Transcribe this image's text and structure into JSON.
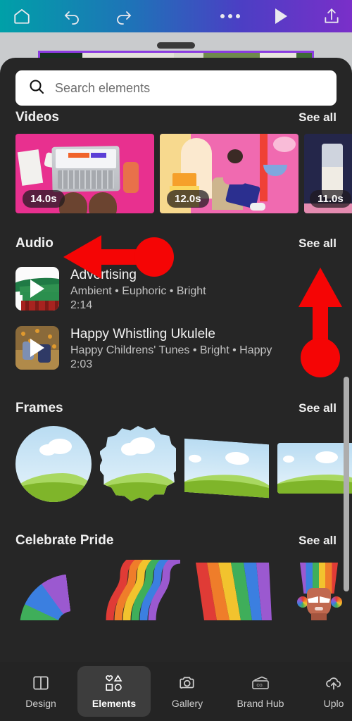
{
  "topbar": {
    "icons": [
      "home-icon",
      "undo-icon",
      "redo-icon",
      "more-options-icon",
      "play-icon",
      "share-icon"
    ],
    "gradient_from": "#00a0a8",
    "gradient_to": "#7a2fc9"
  },
  "search": {
    "placeholder": "Search elements",
    "value": "",
    "icon": "search-icon"
  },
  "sections": {
    "videos": {
      "title": "Videos",
      "see_all": "See all",
      "items": [
        {
          "duration": "14.0s",
          "art": "laptop-desk-flatlay"
        },
        {
          "duration": "12.0s",
          "art": "woman-headphones-pink-room"
        },
        {
          "duration": "11.0s",
          "art": "wine-glass-dark"
        }
      ]
    },
    "audio": {
      "title": "Audio",
      "see_all": "See all",
      "tracks": [
        {
          "title": "Advertising",
          "tags": "Ambient • Euphoric • Bright",
          "duration": "2:14",
          "art": "korean-temple"
        },
        {
          "title": "Happy Whistling Ukulele",
          "tags": "Happy Childrens' Tunes • Bright • Happy",
          "duration": "2:03",
          "art": "children-autumn-leaves"
        }
      ]
    },
    "frames": {
      "title": "Frames",
      "see_all": "See all",
      "items": [
        "circle-frame",
        "scalloped-frame",
        "skewed-rectangle-frame",
        "rectangle-frame"
      ]
    },
    "pride": {
      "title": "Celebrate Pride",
      "see_all": "See all",
      "items": [
        "rainbow-curve",
        "rainbow-wave",
        "rainbow-fan",
        "drag-queen-rainbow-hair"
      ]
    }
  },
  "bottom_nav": {
    "items": [
      {
        "label": "Design",
        "icon": "layout-icon",
        "active": false
      },
      {
        "label": "Elements",
        "icon": "shapes-icon",
        "active": true
      },
      {
        "label": "Gallery",
        "icon": "camera-icon",
        "active": false
      },
      {
        "label": "Brand Hub",
        "icon": "brand-card-icon",
        "active": false
      },
      {
        "label": "Uplo",
        "icon": "cloud-upload-icon",
        "active": false
      }
    ]
  },
  "annotations": {
    "color": "#f50505",
    "left_arrow_target": "Audio",
    "up_arrow_target": "See all"
  }
}
